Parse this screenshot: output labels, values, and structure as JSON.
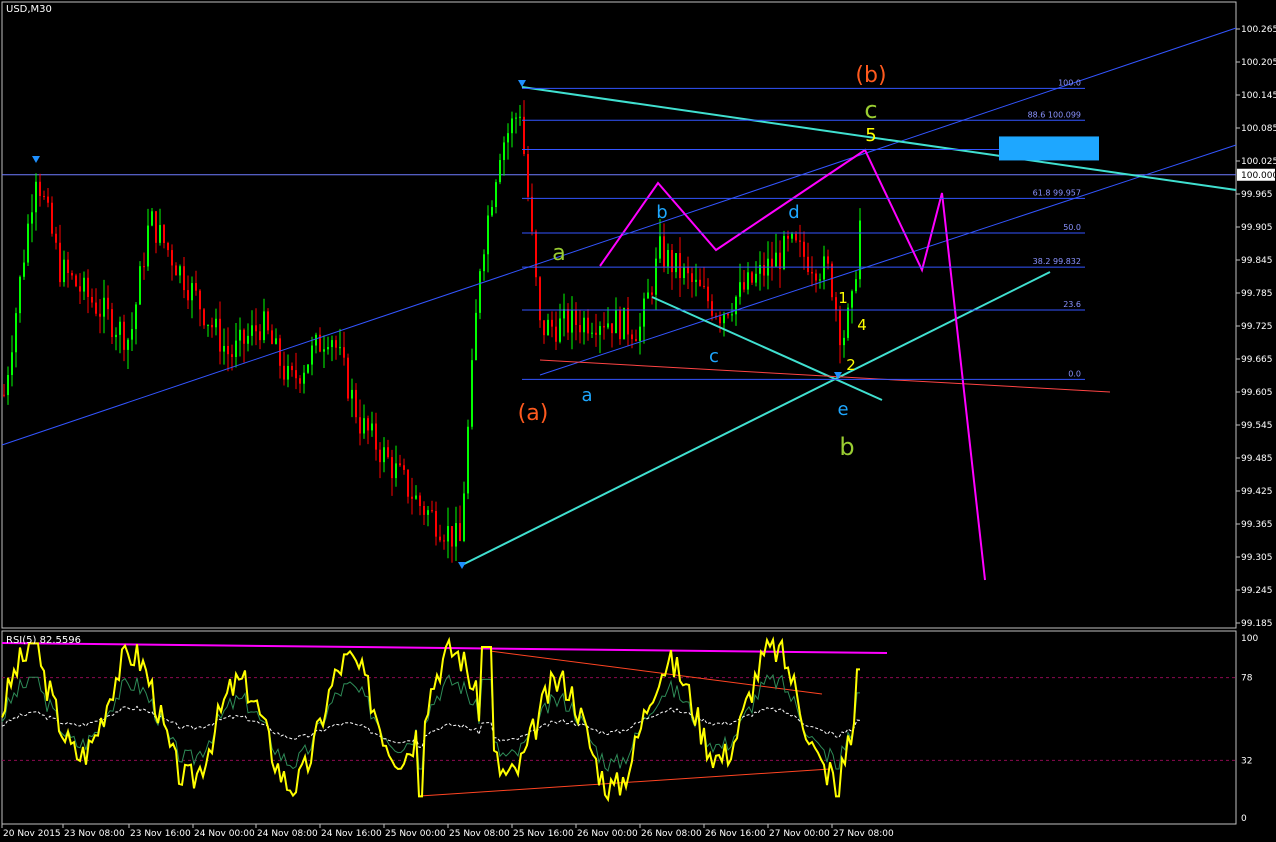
{
  "header": {
    "symbol": "USD,M30",
    "rsi_title": "RSI(5) 82.5596"
  },
  "colors": {
    "background": "#000000",
    "bull_candle": "#00ff00",
    "bear_candle": "#ff0000",
    "trendline": "#3355ff",
    "fib": "#3355ff",
    "cyan_line": "#40e0d0",
    "magenta_line": "#ff00ff",
    "rsi_line": "#ffff00",
    "rsi_level": "#8b0a50",
    "current_price_box": "#ffffff",
    "fib_highlight": "#1ea7ff"
  },
  "chart_data": {
    "type": "candlestick",
    "symbol": "USD",
    "timeframe": "M30",
    "y_ticks": [
      "100.265",
      "100.205",
      "100.145",
      "100.085",
      "100.025",
      "99.965",
      "99.905",
      "99.845",
      "99.785",
      "99.725",
      "99.665",
      "99.605",
      "99.545",
      "99.485",
      "99.425",
      "99.365",
      "99.305",
      "99.245",
      "99.185"
    ],
    "ylim": [
      99.17,
      100.28
    ],
    "current_price": "100.000",
    "x_ticks": [
      "20 Nov 2015",
      "23 Nov 08:00",
      "23 Nov 16:00",
      "24 Nov 00:00",
      "24 Nov 08:00",
      "24 Nov 16:00",
      "25 Nov 00:00",
      "25 Nov 08:00",
      "25 Nov 16:00",
      "26 Nov 00:00",
      "26 Nov 08:00",
      "26 Nov 16:00",
      "27 Nov 00:00",
      "27 Nov 08:00"
    ],
    "fib_levels": [
      {
        "label": "100.0",
        "value": 100.157
      },
      {
        "label": "88.6 100.099",
        "value": 100.099
      },
      {
        "label": "78.6 100.046",
        "value": 100.046
      },
      {
        "label": "61.8 99.957",
        "value": 99.957
      },
      {
        "label": "50.0",
        "value": 99.894
      },
      {
        "label": "38.2 99.832",
        "value": 99.832
      },
      {
        "label": "23.6",
        "value": 99.754
      },
      {
        "label": "0.0",
        "value": 99.628
      }
    ],
    "wave_labels": [
      "(b)",
      "c",
      "5",
      "b",
      "d",
      "a",
      "c",
      "1",
      "4",
      "2",
      "(a)",
      "a",
      "e",
      "b"
    ],
    "rsi": {
      "name": "RSI(5)",
      "last": 82.5596,
      "levels": [
        "78",
        "32"
      ],
      "ylim": [
        0,
        100
      ],
      "y_ticks": [
        "100",
        "78",
        "32",
        "0"
      ]
    }
  }
}
